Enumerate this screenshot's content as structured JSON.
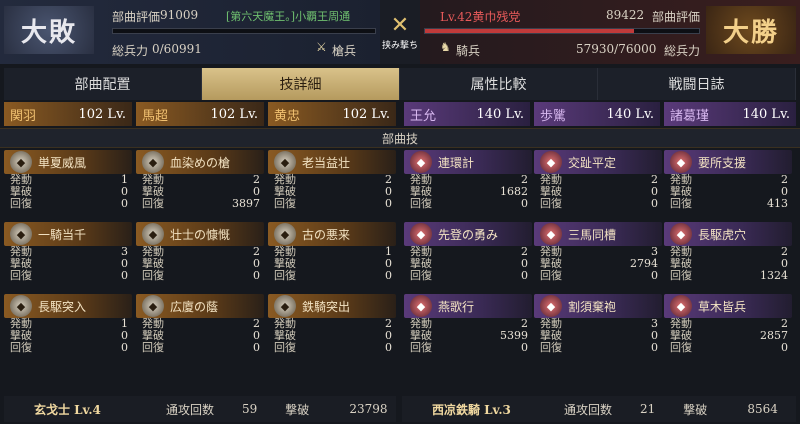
{
  "header": {
    "left": {
      "result": "大敗",
      "rating_label": "部曲評価",
      "rating": "91009",
      "title": "[第六天魔王。]小覇王周通",
      "troops_label": "総兵力",
      "troops": "0/60991",
      "unit_type": "槍兵",
      "troops_fraction": 0
    },
    "right": {
      "result": "大勝",
      "level_name": "Lv.42黄巾残党",
      "rating": "89422",
      "rating_label": "部曲評価",
      "troops": "57930/76000",
      "troops_label": "総兵力",
      "unit_type": "騎兵",
      "troops_fraction": 0.762
    },
    "center_label": "挟み撃ち"
  },
  "tabs": [
    {
      "label": "部曲配置",
      "active": false
    },
    {
      "label": "技詳細",
      "active": true
    },
    {
      "label": "属性比較",
      "active": false
    },
    {
      "label": "戦闘日誌",
      "active": false
    }
  ],
  "generals": {
    "left": [
      {
        "name": "関羽",
        "level": "102 Lv."
      },
      {
        "name": "馬超",
        "level": "102 Lv."
      },
      {
        "name": "黄忠",
        "level": "102 Lv."
      }
    ],
    "right": [
      {
        "name": "王允",
        "level": "140 Lv."
      },
      {
        "name": "歩騭",
        "level": "140 Lv."
      },
      {
        "name": "諸葛瑾",
        "level": "140 Lv."
      }
    ]
  },
  "section_title": "部曲技",
  "stat_labels": [
    "発動",
    "撃破",
    "回復"
  ],
  "left_skills": [
    [
      {
        "name": "単夏威風",
        "vals": [
          "1",
          "0",
          "0"
        ]
      },
      {
        "name": "一騎当千",
        "vals": [
          "3",
          "0",
          "0"
        ]
      },
      {
        "name": "長駆突入",
        "vals": [
          "1",
          "0",
          "0"
        ]
      }
    ],
    [
      {
        "name": "血染めの槍",
        "vals": [
          "2",
          "0",
          "3897"
        ]
      },
      {
        "name": "壮士の慷慨",
        "vals": [
          "2",
          "0",
          "0"
        ]
      },
      {
        "name": "広廈の蔭",
        "vals": [
          "2",
          "0",
          "0"
        ]
      }
    ],
    [
      {
        "name": "老当益壮",
        "vals": [
          "2",
          "0",
          "0"
        ]
      },
      {
        "name": "古の悪来",
        "vals": [
          "1",
          "0",
          "0"
        ]
      },
      {
        "name": "鉄騎突出",
        "vals": [
          "2",
          "0",
          "0"
        ]
      }
    ]
  ],
  "right_skills": [
    [
      {
        "name": "連環計",
        "vals": [
          "2",
          "1682",
          "0"
        ]
      },
      {
        "name": "先登の勇み",
        "vals": [
          "2",
          "0",
          "0"
        ]
      },
      {
        "name": "燕歌行",
        "vals": [
          "2",
          "5399",
          "0"
        ]
      }
    ],
    [
      {
        "name": "交趾平定",
        "vals": [
          "2",
          "0",
          "0"
        ]
      },
      {
        "name": "三馬同槽",
        "vals": [
          "3",
          "2794",
          "0"
        ]
      },
      {
        "name": "割須棄袍",
        "vals": [
          "3",
          "0",
          "0"
        ]
      }
    ],
    [
      {
        "name": "要所支援",
        "vals": [
          "2",
          "0",
          "413"
        ]
      },
      {
        "name": "長駆虎穴",
        "vals": [
          "2",
          "0",
          "1324"
        ]
      },
      {
        "name": "草木皆兵",
        "vals": [
          "2",
          "2857",
          "0"
        ]
      }
    ]
  ],
  "footer": {
    "left": {
      "unit": "玄戈士 Lv.4",
      "attack_label": "通攻回数",
      "attack": "59",
      "kill_label": "撃破",
      "kills": "23798"
    },
    "right": {
      "unit": "西凉鉄騎 Lv.3",
      "attack_label": "通攻回数",
      "attack": "21",
      "kill_label": "撃破",
      "kills": "8564"
    }
  },
  "colors": {
    "accent_gold": "#d9c28a",
    "left_bar": "#4a6a9a",
    "right_bar": "#c03a3a"
  }
}
